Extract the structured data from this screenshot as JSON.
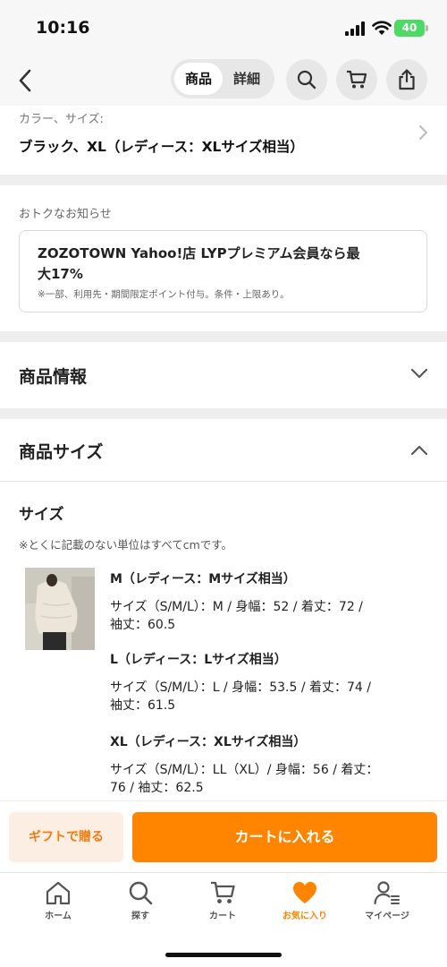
{
  "status_bar": {
    "time": "10:16",
    "battery": "40"
  },
  "header": {
    "tabs": [
      {
        "label": "商品",
        "active": true
      },
      {
        "label": "詳細",
        "active": false
      }
    ],
    "icons": [
      "chevron-left-icon",
      "search-icon",
      "cart-icon",
      "share-icon"
    ]
  },
  "selection": {
    "label": "カラー、サイズ:",
    "value": "ブラック、XL（レディース：XLサイズ相当）"
  },
  "notice": {
    "heading": "おトクなお知らせ",
    "title_line1": "ZOZOTOWN Yahoo!店 LYPプレミアム会員なら最",
    "title_line2": "大17%",
    "note": "※一部、利用先・期間限定ポイント付与。条件・上限あり。"
  },
  "product_info": {
    "title": "商品情報"
  },
  "product_size": {
    "title": "商品サイズ",
    "subtitle": "サイズ",
    "unit_note": "※とくに記載のない単位はすべてcmです。",
    "sizes": [
      {
        "name": "M（レディース：Mサイズ相当）",
        "line1": "サイズ（S/M/L）：M / 身幅：52 / 着丈：72 /",
        "line2": "袖丈：60.5"
      },
      {
        "name": "L（レディース：Lサイズ相当）",
        "line1": "サイズ（S/M/L）：L / 身幅：53.5 / 着丈：74 /",
        "line2": "袖丈：61.5"
      },
      {
        "name": "XL（レディース：XLサイズ相当）",
        "line1": "サイズ（S/M/L）：LL（XL）/ 身幅：56 / 着丈：",
        "line2": "76 / 袖丈：62.5"
      }
    ]
  },
  "actions": {
    "gift_label": "ギフトで贈る",
    "cart_label": "カートに入れる"
  },
  "tabbar": {
    "items": [
      {
        "label": "ホーム",
        "icon": "home-icon"
      },
      {
        "label": "探す",
        "icon": "search-icon"
      },
      {
        "label": "カート",
        "icon": "cart-icon"
      },
      {
        "label": "お気に入り",
        "icon": "heart-icon",
        "active": true
      },
      {
        "label": "マイページ",
        "icon": "user-icon"
      }
    ]
  },
  "colors": {
    "accent": "#ff8400",
    "gift_bg": "#fdeee3",
    "band": "#eeeeee"
  }
}
